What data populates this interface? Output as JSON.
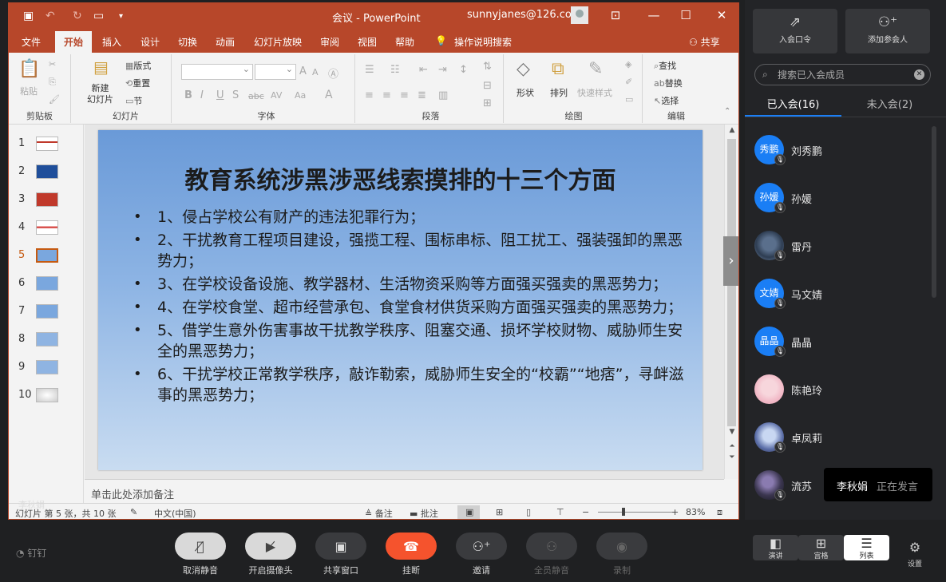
{
  "ppt": {
    "window_title": "会议  -  PowerPoint",
    "user_email": "sunnyjanes@126.com",
    "tabs": [
      "文件",
      "开始",
      "插入",
      "设计",
      "切换",
      "动画",
      "幻灯片放映",
      "审阅",
      "视图",
      "帮助",
      "操作说明搜索"
    ],
    "active_tab": "开始",
    "share_label": "共享",
    "ribbon": {
      "clipboard": {
        "paste": "粘贴",
        "group": "剪贴板"
      },
      "slides": {
        "new_slide": "新建\n幻灯片",
        "layout": "版式",
        "reset": "重置",
        "section": "节",
        "group": "幻灯片"
      },
      "font": {
        "group": "字体",
        "bold": "B",
        "italic": "I",
        "underline": "U",
        "strike": "S",
        "font_grow": "A",
        "font_shrink": "A",
        "font_color": "A",
        "spacing": "AV",
        "case": "Aa"
      },
      "paragraph": {
        "group": "段落"
      },
      "drawing": {
        "shapes": "形状",
        "arrange": "排列",
        "quick_styles": "快速样式",
        "group": "绘图"
      },
      "editing": {
        "find": "查找",
        "replace": "替换",
        "select": "选择",
        "group": "编辑"
      }
    },
    "slide_numbers": [
      "1",
      "2",
      "3",
      "4",
      "5",
      "6",
      "7",
      "8",
      "9",
      "10"
    ],
    "selected_slide": "5",
    "slide": {
      "title": "教育系统涉黑涉恶线索摸排的十三个方面",
      "bullets": [
        "1、侵占学校公有财产的违法犯罪行为；",
        "2、干扰教育工程项目建设，强揽工程、围标串标、阻工扰工、强装强卸的黑恶势力；",
        "3、在学校设备设施、教学器材、生活物资采购等方面强买强卖的黑恶势力；",
        "4、在学校食堂、超市经营承包、食堂食材供货采购方面强买强卖的黑恶势力；",
        "5、借学生意外伤害事故干扰教学秩序、阻塞交通、损坏学校财物、威胁师生安全的黑恶势力；",
        "6、干扰学校正常教学秩序，敲诈勒索，威胁师生安全的“校霸”“地痞”，寻衅滋事的黑恶势力；"
      ]
    },
    "notes_placeholder": "单击此处添加备注",
    "status": {
      "slide_info": "幻灯片 第 5 张，共 10 张",
      "language": "中文(中国)",
      "notes": "备注",
      "comments": "批注",
      "zoom": "83%",
      "zoom_minus": "−",
      "zoom_plus": "+"
    },
    "speaker_overlay": "李秋娟"
  },
  "controls": {
    "brand": "钉钉",
    "buttons": [
      "取消静音",
      "开启摄像头",
      "共享窗口",
      "挂断",
      "邀请",
      "全员静音",
      "录制"
    ],
    "views": [
      "演讲",
      "宫格",
      "列表"
    ],
    "settings": "设置"
  },
  "panel": {
    "join_code": "入会口令",
    "add_participant": "添加参会人",
    "search_placeholder": "搜索已入会成员",
    "tab_joined": "已入会(16)",
    "tab_not_joined": "未入会(2)",
    "members": [
      {
        "avatar_text": "秀鹏",
        "name": "刘秀鹏"
      },
      {
        "avatar_text": "孙媛",
        "name": "孙媛"
      },
      {
        "avatar_text": "",
        "name": "雷丹"
      },
      {
        "avatar_text": "文婧",
        "name": "马文婧"
      },
      {
        "avatar_text": "晶晶",
        "name": "晶晶"
      },
      {
        "avatar_text": "",
        "name": "陈艳玲"
      },
      {
        "avatar_text": "",
        "name": "卓凤莉"
      },
      {
        "avatar_text": "",
        "name": "流苏"
      }
    ],
    "speaking": {
      "name": "李秋娟",
      "status": "正在发言"
    }
  },
  "colors": {
    "ppt_accent": "#b7472a",
    "hangup": "#f5532d",
    "dingtalk_blue": "#1a7ef5"
  }
}
